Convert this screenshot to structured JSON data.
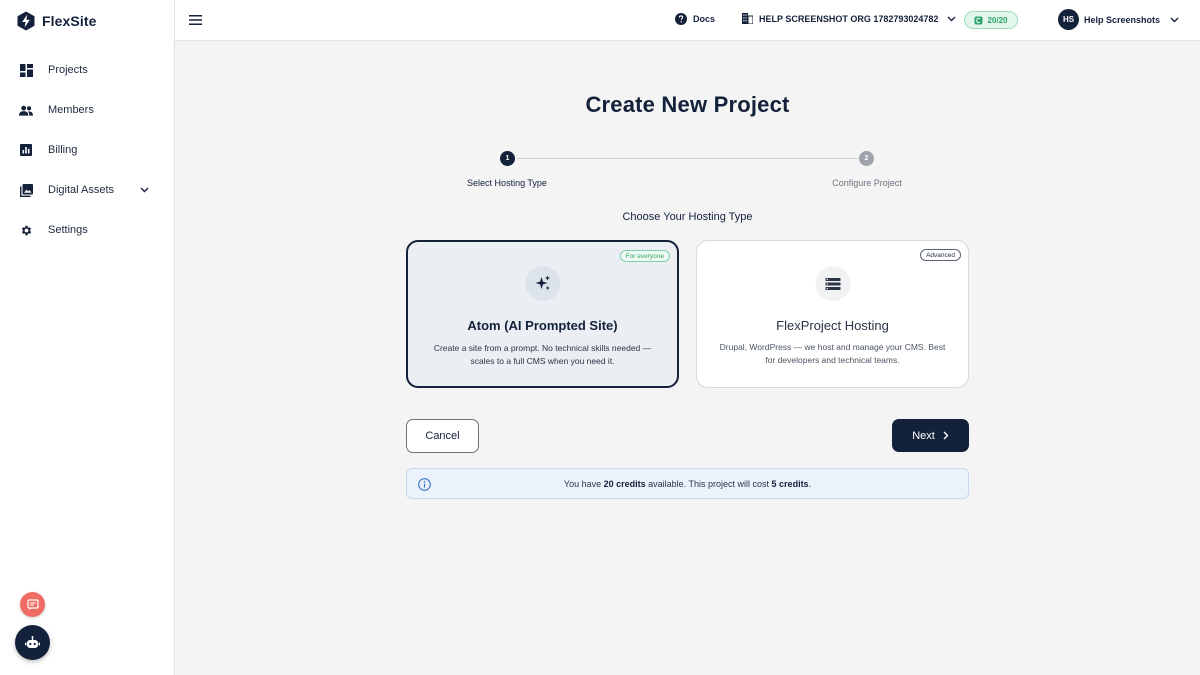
{
  "brand": {
    "name": "FlexSite"
  },
  "sidebar": {
    "items": [
      {
        "label": "Projects",
        "icon": "dashboard-icon"
      },
      {
        "label": "Members",
        "icon": "people-icon"
      },
      {
        "label": "Billing",
        "icon": "chart-icon"
      },
      {
        "label": "Digital Assets",
        "icon": "image-icon",
        "expandable": true
      },
      {
        "label": "Settings",
        "icon": "gear-icon"
      }
    ]
  },
  "header": {
    "docs_label": "Docs",
    "org_label": "HELP SCREENSHOT ORG 1782793024782",
    "credits_pill": "20/20",
    "user_initials": "HS",
    "user_name": "Help Screenshots"
  },
  "page": {
    "title": "Create New Project",
    "steps": [
      {
        "number": "1",
        "label": "Select Hosting Type",
        "active": true
      },
      {
        "number": "2",
        "label": "Configure Project",
        "active": false
      }
    ],
    "section_title": "Choose Your Hosting Type",
    "cards": [
      {
        "badge": "For everyone",
        "title": "Atom (AI Prompted Site)",
        "description": "Create a site from a prompt. No technical skills needed — scales to a full CMS when you need it.",
        "selected": true
      },
      {
        "badge": "Advanced",
        "title": "FlexProject Hosting",
        "description": "Drupal, WordPress — we host and manage your CMS. Best for developers and technical teams.",
        "selected": false
      }
    ],
    "cancel_label": "Cancel",
    "next_label": "Next",
    "info": {
      "prefix": "You have ",
      "credits": "20 credits",
      "middle": " available. This project will cost ",
      "cost": "5 credits",
      "suffix": "."
    }
  },
  "colors": {
    "primary": "#13213a",
    "accent_green": "#2ca36a",
    "feedback": "#ef6b63",
    "info_bg": "#ebf2fb"
  }
}
